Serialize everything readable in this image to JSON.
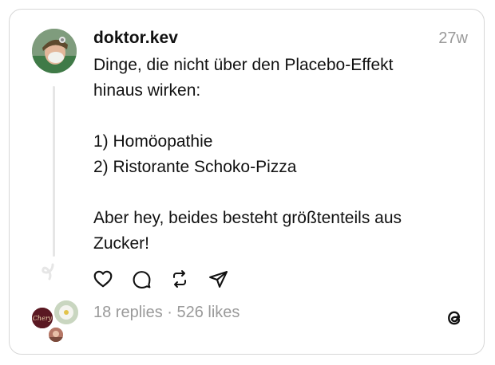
{
  "post": {
    "username": "doktor.kev",
    "timestamp": "27w",
    "lines": [
      "Dinge, die nicht über den Placebo-Effekt",
      "hinaus wirken:",
      "",
      "1) Homöopathie",
      "2) Ristorante Schoko-Pizza",
      "",
      "Aber hey, beides besteht größtenteils aus",
      "Zucker!"
    ]
  },
  "actions": {
    "like": "heart-icon",
    "reply": "comment-icon",
    "repost": "repost-icon",
    "share": "send-icon"
  },
  "stats": {
    "summary": "18 replies · 526 likes"
  },
  "repliers": {
    "first_avatar_text": "Chery"
  },
  "colors": {
    "text": "#111111",
    "muted": "#9a9a9a",
    "border": "#d7d7d7",
    "thread_line": "#e6e6e6"
  }
}
